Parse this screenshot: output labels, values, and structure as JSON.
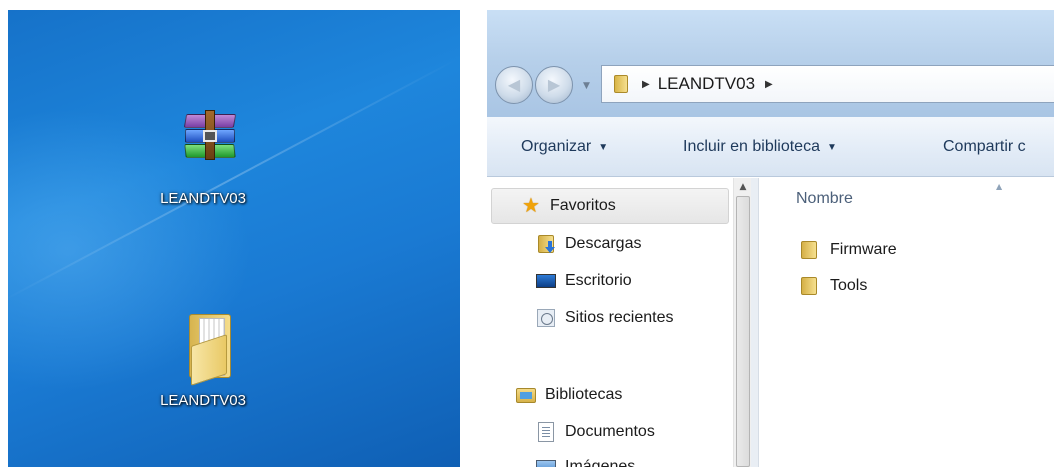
{
  "desktop": {
    "icons": [
      {
        "label": "LEANDTV03",
        "icon": "winrar-archive-icon"
      },
      {
        "label": "LEANDTV03",
        "icon": "folder-icon"
      }
    ]
  },
  "explorer": {
    "address": {
      "segments": [
        "LEANDTV03"
      ]
    },
    "toolbar": {
      "organize": "Organizar",
      "include": "Incluir en biblioteca",
      "share": "Compartir c"
    },
    "nav": {
      "favorites": "Favoritos",
      "downloads": "Descargas",
      "desktop": "Escritorio",
      "recent": "Sitios recientes",
      "libraries": "Bibliotecas",
      "documents": "Documentos",
      "pictures": "Imágenes"
    },
    "content": {
      "column_name": "Nombre",
      "items": [
        {
          "name": "Firmware",
          "icon": "folder-icon"
        },
        {
          "name": "Tools",
          "icon": "folder-icon"
        }
      ]
    }
  }
}
